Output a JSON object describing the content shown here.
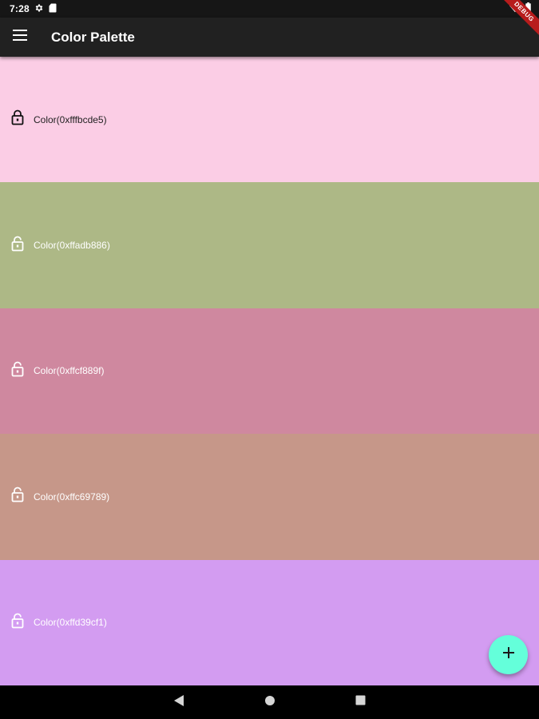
{
  "status_bar": {
    "time": "7:28",
    "icons": [
      "settings-icon",
      "sd-card-icon",
      "wifi-icon",
      "battery-icon"
    ],
    "debug_banner": "DEBUG"
  },
  "app_bar": {
    "menu_icon": "hamburger-menu-icon",
    "title": "Color Palette"
  },
  "palette": [
    {
      "label": "Color(0xfffbcde5)",
      "color": "#fbcde5",
      "text_color": "#222222",
      "icon_color": "#111111",
      "locked": true
    },
    {
      "label": "Color(0xffadb886)",
      "color": "#adb886",
      "text_color": "#ffffff",
      "icon_color": "#ffffff",
      "locked": false
    },
    {
      "label": "Color(0xffcf889f)",
      "color": "#cf889f",
      "text_color": "#ffffff",
      "icon_color": "#ffffff",
      "locked": false
    },
    {
      "label": "Color(0xffc69789)",
      "color": "#c69789",
      "text_color": "#ffffff",
      "icon_color": "#ffffff",
      "locked": false
    },
    {
      "label": "Color(0xffd39cf1)",
      "color": "#d39cf1",
      "text_color": "#ffffff",
      "icon_color": "#ffffff",
      "locked": false
    }
  ],
  "fab": {
    "icon": "plus-icon",
    "color": "#64ffda"
  },
  "nav_bar": {
    "buttons": [
      "back-icon",
      "home-icon",
      "recents-icon"
    ]
  }
}
